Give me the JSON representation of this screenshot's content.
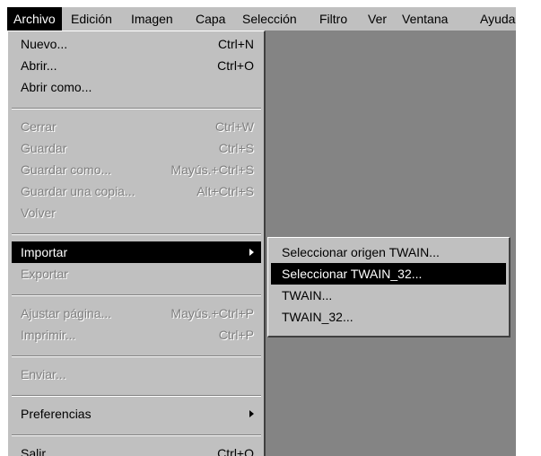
{
  "menubar": {
    "items": [
      "Archivo",
      "Edición",
      "Imagen",
      "Capa",
      "Selección",
      "Filtro",
      "Ver",
      "Ventana",
      "Ayuda"
    ]
  },
  "file_menu": {
    "nuevo": {
      "label": "Nuevo...",
      "shortcut": "Ctrl+N"
    },
    "abrir": {
      "label": "Abrir...",
      "shortcut": "Ctrl+O"
    },
    "abrir_como": {
      "label": "Abrir como..."
    },
    "cerrar": {
      "label": "Cerrar",
      "shortcut": "Ctrl+W"
    },
    "guardar": {
      "label": "Guardar",
      "shortcut": "Ctrl+S"
    },
    "guardar_como": {
      "label": "Guardar como...",
      "shortcut": "Mayús.+Ctrl+S"
    },
    "guardar_copia": {
      "label": "Guardar una copia...",
      "shortcut": "Alt+Ctrl+S"
    },
    "volver": {
      "label": "Volver"
    },
    "importar": {
      "label": "Importar"
    },
    "exportar": {
      "label": "Exportar"
    },
    "ajustar_pagina": {
      "label": "Ajustar página...",
      "shortcut": "Mayús.+Ctrl+P"
    },
    "imprimir": {
      "label": "Imprimir...",
      "shortcut": "Ctrl+P"
    },
    "enviar": {
      "label": "Enviar..."
    },
    "preferencias": {
      "label": "Preferencias"
    },
    "salir": {
      "label": "Salir",
      "shortcut": "Ctrl+Q"
    }
  },
  "import_submenu": {
    "items": [
      "Seleccionar origen TWAIN...",
      "Seleccionar TWAIN_32...",
      "TWAIN...",
      "TWAIN_32..."
    ]
  },
  "colors": {
    "menu_bg": "#c0c0c0",
    "workspace_bg": "#848484",
    "highlight_bg": "#000000",
    "disabled_text": "#808080"
  }
}
